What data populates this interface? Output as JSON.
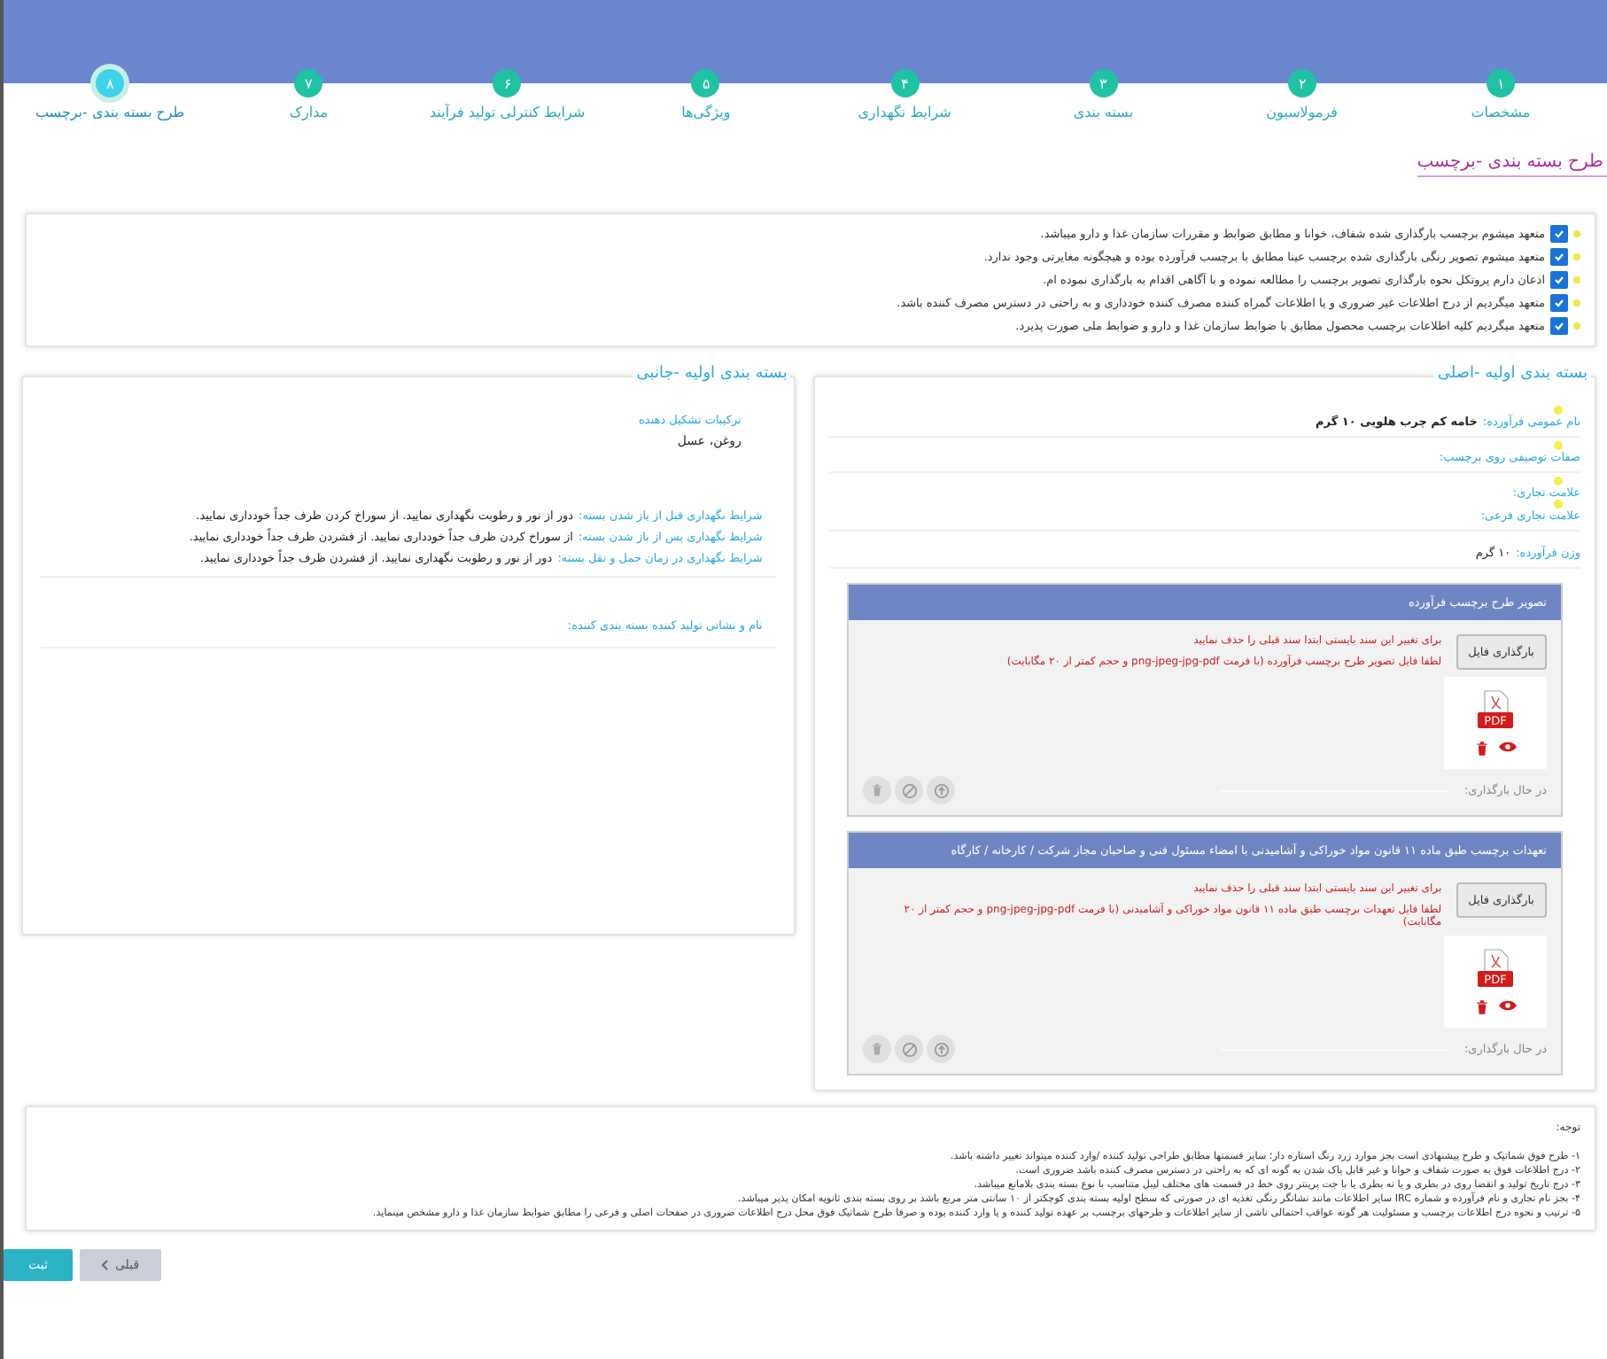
{
  "steps": [
    {
      "number": "۱",
      "label": "مشخصات",
      "selected": false
    },
    {
      "number": "۲",
      "label": "فرمولاسیون",
      "selected": false
    },
    {
      "number": "۳",
      "label": "بسته بندی",
      "selected": false
    },
    {
      "number": "۴",
      "label": "شرایط نگهداری",
      "selected": false
    },
    {
      "number": "۵",
      "label": "ویژگی‌ها",
      "selected": false
    },
    {
      "number": "۶",
      "label": "شرایط کنترلی تولید فرآیند",
      "selected": false
    },
    {
      "number": "۷",
      "label": "مدارک",
      "selected": false
    },
    {
      "number": "۸",
      "label": "طرح بسته بندی -برچسب",
      "selected": true
    }
  ],
  "page_title": "طرح بسته بندی -برچسب",
  "pledges": [
    {
      "text": "متعهد میشوم برچسب بارگذاری شده شفاف، خوانا و مطابق ضوابط و مقررات سازمان غذا و دارو میباشد.",
      "checked": true
    },
    {
      "text": "متعهد میشوم تصویر رنگی بارگذاری شده برچسب عینا مطابق با برچسب فرآورده بوده و هیچگونه مغایرتی وجود ندارد.",
      "checked": true
    },
    {
      "text": "اذعان دارم پروتکل نحوه بارگذاری تصویر برچسب را مطالعه نموده و با آگاهی اقدام به بارگذاری نموده ام.",
      "checked": true
    },
    {
      "text": "متعهد میگردیم از درج اطلاعات غیر ضروری و یا اطلاعات گمراه کننده مصرف کننده خودداری و به راحتی در دسترس مصرف کننده باشد.",
      "checked": true
    },
    {
      "text": "متعهد میگردیم کلیه اطلاعات برچسب محصول مطابق با ضوابط سازمان غذا و دارو و ضوابط ملی صورت پذیرد.",
      "checked": true
    }
  ],
  "main_panel": {
    "title": "بسته بندی اولیه -اصلی",
    "generic_name": {
      "label": "نام عمومی فرآورده:",
      "value": "خامه کم چرب هلویی ۱۰ گرم"
    },
    "descriptive": {
      "label": "صفات توصیفی روی برچسب:"
    },
    "brand": {
      "label": "علامت تجاری:"
    },
    "sub_brand": {
      "label": "علامت تجاری فرعی:"
    },
    "weight": {
      "label": "وزن فرآورده:",
      "value": "۱۰ گرم"
    },
    "uploads": [
      {
        "title": "تصویر طرح برچسب فرآورده",
        "button": "بارگذاری فایل",
        "warning": "برای تغییر این سند بایستی ابتدا سند قبلی را حذف نمایید",
        "hint": "لطفا فایل تصویر طرح برچسب فرآورده (با فرمت png-jpeg-jpg-pdf و حجم کمتر از ۲۰ مگابایت)",
        "file_type": "PDF",
        "progress_label": "در حال بارگذاری:"
      },
      {
        "title": "تعهدات برچسب طبق ماده ۱۱ قانون مواد خوراکی و آشامیدنی با امضاء مسئول فنی و صاحبان مجاز شرکت / کارخانه / کارگاه",
        "button": "بارگذاری فایل",
        "warning": "برای تغییر این سند بایستی ابتدا سند قبلی را حذف نمایید",
        "hint": "لطفا فایل تعهدات برچسب طبق ماده ۱۱ قانون مواد خوراکی و آشامیدنی (با فرمت png-jpeg-jpg-pdf و حجم کمتر از ۲۰ مگابایت)",
        "file_type": "PDF",
        "progress_label": "در حال بارگذاری:"
      }
    ]
  },
  "side_panel": {
    "title": "بسته بندی اولیه -جانبی",
    "ingredients": {
      "label": "ترکیبات تشکیل دهنده",
      "value": "روغن، عسل"
    },
    "storage": [
      {
        "label": "شرایط نگهداری قبل از باز شدن بسته:",
        "value": "دور از نور و رطوبت نگهداری نمایید. از سوراخ کردن ظرف جداً خودداری نمایید."
      },
      {
        "label": "شرایط نگهداری پس از باز شدن بسته:",
        "value": "از سوراخ کردن ظرف جداً خودداری نمایید. از فشردن ظرف جداً خودداری نمایید."
      },
      {
        "label": "شرایط نگهداری در زمان حمل و نقل بسته:",
        "value": "دور از نور و رطوبت نگهداری نمایید. از فشردن ظرف جداً خودداری نمایید."
      }
    ],
    "producer": {
      "label": "نام و نشانی تولید کننده بسته بندی کننده:"
    }
  },
  "notes": {
    "title": "توجه:",
    "lines": [
      "۱- طرح فوق شماتیک و طرح پیشنهادی است بجز موارد زرد رنگ استاره دار؛ سایر قسمتها مطابق طراحی تولید کننده /وارد کننده میتواند تغییر داشته باشد.",
      "۲- درج اطلاعات فوق به صورت شفاف و خوانا و غیر قابل پاک شدن به گونه ای که به راحتی در دسترس مصرف کننده باشد ضروری است.",
      "۳- درج تاریخ تولید و انقضا روی در بطری و یا ته بطری یا با جت پرینتر روی خط در قسمت های مختلف لیبل متناسب با نوع بسته بندی بلامانع میباشد.",
      "۴- بجز نام تجاری و نام فرآورده و شماره IRC سایر اطلاعات مانند نشانگر رنگی تغذیه ای در صورتی که سطح اولیه بسته بندی کوچکتر از ۱۰ سانتی متر مربع باشد بر روی بسته بندی ثانویه امکان پذیر میباشد.",
      "۵- ترتیب و نحوه درج اطلاعات برچسب و مسئولیت هر گونه عواقب احتمالی ناشی از سایر اطلاعات و طرحهای برچسب بر عهده تولید کننده و یا وارد کننده بوده و صرفا طرح شماتیک فوق محل درج اطلاعات ضروری در صفحات اصلی و فرعی را مطابق ضوابط سازمان غذا و دارو مشخص مینماید."
    ]
  },
  "buttons": {
    "submit": "ثبت",
    "previous": "قبلی"
  }
}
